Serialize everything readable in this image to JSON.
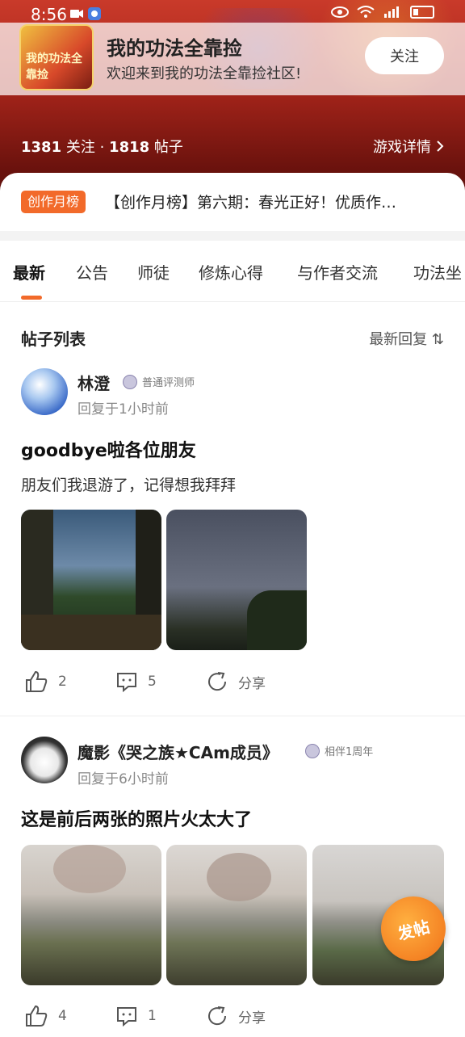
{
  "status_bar": {
    "time": "8:56"
  },
  "forum": {
    "logo_text": "我的功法全靠捡",
    "title": "我的功法全靠捡",
    "subtitle": "欢迎来到我的功法全靠捡社区!",
    "follow_label": "关注",
    "followers": "1381",
    "followers_label": "关注",
    "separator": "·",
    "posts": "1818",
    "posts_label": "帖子",
    "details_label": "游戏详情"
  },
  "announcement": {
    "tag": "创作月榜",
    "text": "【创作月榜】第六期：春光正好！优质作…"
  },
  "tabs": [
    "最新",
    "公告",
    "师徒",
    "修炼心得",
    "与作者交流",
    "功法坐"
  ],
  "list": {
    "title": "帖子列表",
    "sort_label": "最新回复 ⇅"
  },
  "posts": [
    {
      "user": "林澄",
      "badge": "普通评测师",
      "reply_time": "回复于1小时前",
      "title": "goodbye啦各位朋友",
      "body": "朋友们我退游了，记得想我拜拜",
      "likes": "2",
      "comments": "5",
      "share_label": "分享"
    },
    {
      "user": "魔影《哭之族★CAm成员》",
      "badge": "相伴1周年",
      "reply_time": "回复于6小时前",
      "title": "这是前后两张的照片火太大了",
      "likes": "4",
      "comments": "1",
      "share_label": "分享"
    }
  ],
  "fab_label": "发帖",
  "colors": {
    "accent": "#f26a2a",
    "hero": "#a8251b"
  }
}
